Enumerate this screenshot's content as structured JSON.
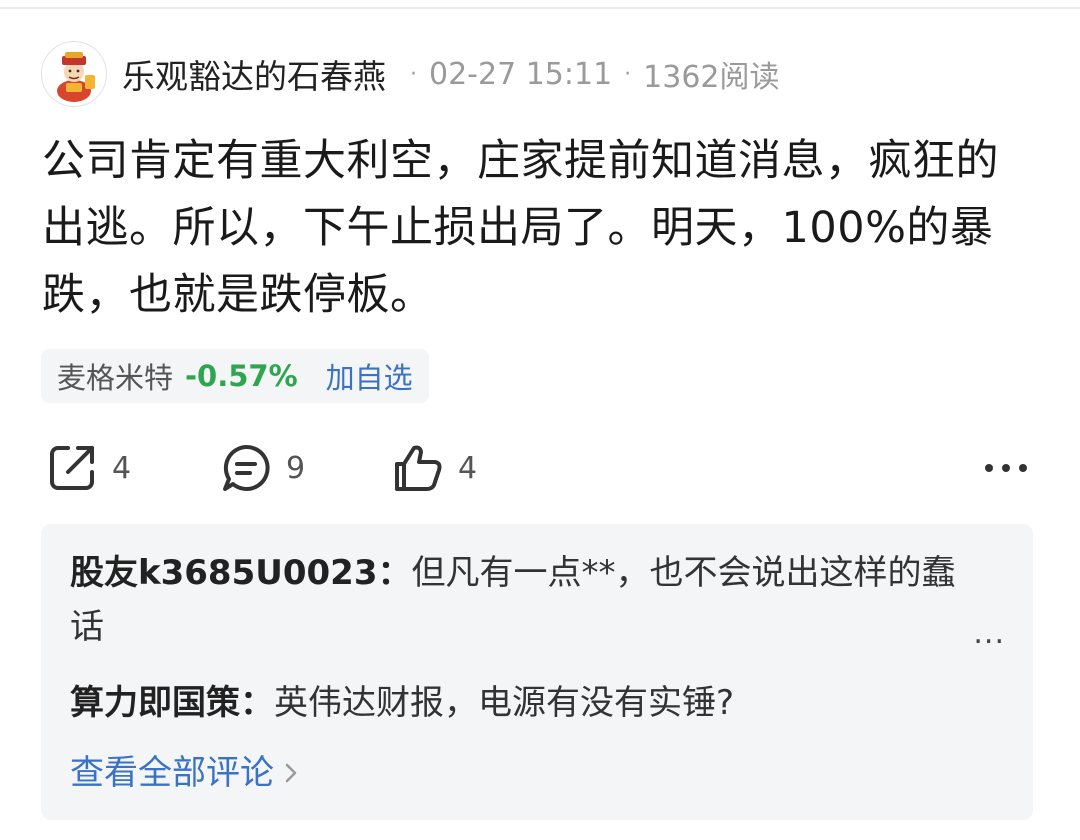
{
  "header": {
    "username": "乐观豁达的石春燕",
    "separator": "·",
    "datetime": "02-27 15:11",
    "reads": "1362阅读"
  },
  "post": {
    "text": "公司肯定有重大利空，庄家提前知道消息，疯狂的出逃。所以，下午止损出局了。明天，100%的暴跌，也就是跌停板。"
  },
  "stock_chip": {
    "name": "麦格米特",
    "change": "-0.57%",
    "add_label": "加自选",
    "change_color": "#2ea64f"
  },
  "actions": {
    "share_count": "4",
    "comment_count": "9",
    "like_count": "4",
    "more_icon": "more-dots-icon"
  },
  "comments": {
    "items": [
      {
        "author": "股友k3685U0023",
        "sep": "：",
        "text": "但凡有一点**，也不会说出这样的蠢话"
      },
      {
        "author": "算力即国策",
        "sep": "：",
        "text": "英伟达财报，电源有没有实锤?"
      }
    ],
    "more_marker": "...",
    "view_all": "查看全部评论"
  },
  "colors": {
    "accent_blue": "#3a72c5",
    "gain_green": "#2ea64f",
    "panel_bg": "#f4f5f7"
  }
}
